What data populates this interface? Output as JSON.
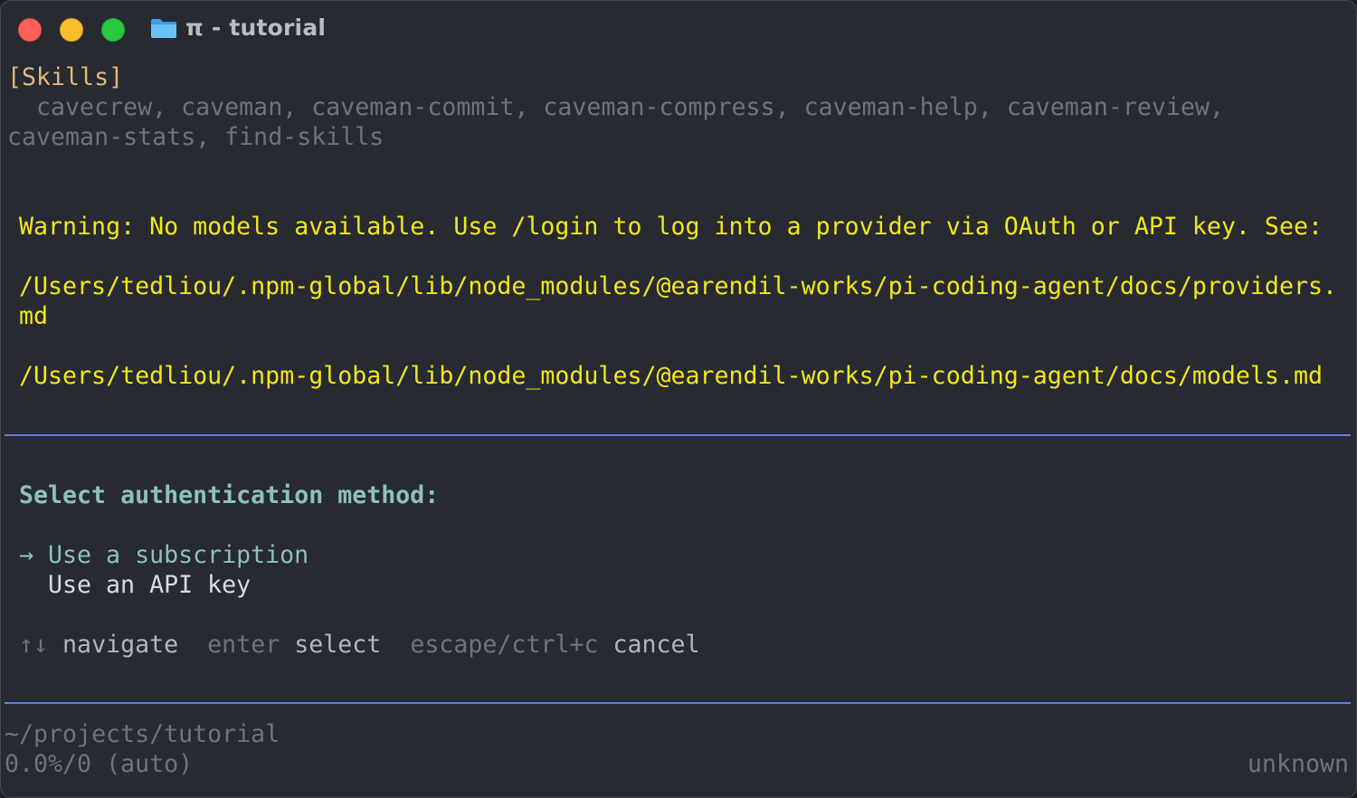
{
  "window": {
    "title": "π - tutorial",
    "icon": "folder-icon"
  },
  "skills": {
    "header": "[Skills]",
    "line1": "  cavecrew, caveman, caveman-commit, caveman-compress, caveman-help, caveman-review,",
    "line2": "caveman-stats, find-skills"
  },
  "warning": {
    "line1": "Warning: No models available. Use /login to log into a provider via OAuth or API key. See:",
    "line2": "/Users/tedliou/.npm-global/lib/node_modules/@earendil-works/pi-coding-agent/docs/providers.",
    "line3": "md",
    "line4": "/Users/tedliou/.npm-global/lib/node_modules/@earendil-works/pi-coding-agent/docs/models.md"
  },
  "auth": {
    "title": "Select authentication method:",
    "arrow": "→",
    "options": [
      "Use a subscription",
      "Use an API key"
    ],
    "selected_index": 0
  },
  "hints": [
    {
      "key": "↑↓",
      "action": "navigate"
    },
    {
      "key": "enter",
      "action": "select"
    },
    {
      "key": "escape/ctrl+c",
      "action": "cancel"
    }
  ],
  "footer": {
    "path": "~/projects/tutorial",
    "context": "0.0%/0 (auto)",
    "model": "unknown"
  },
  "colors": {
    "background": "#272a31",
    "warning": "#f3e716",
    "accent_teal": "#8ec0ba",
    "rule_blue": "#5c7ee0",
    "muted": "#6f737c",
    "skills_header": "#e0b97a"
  }
}
